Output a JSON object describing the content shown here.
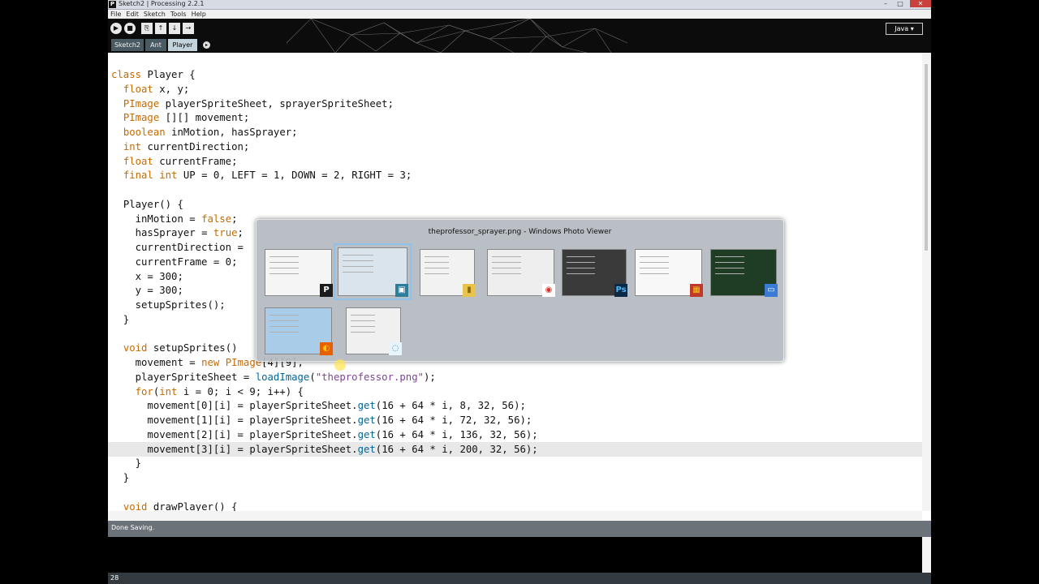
{
  "window": {
    "title": "Sketch2 | Processing 2.2.1",
    "controls": [
      "–",
      "□",
      "✕"
    ]
  },
  "menu": [
    "File",
    "Edit",
    "Sketch",
    "Tools",
    "Help"
  ],
  "toolbar": {
    "buttons": [
      {
        "name": "run",
        "glyph": "▶"
      },
      {
        "name": "stop",
        "glyph": "■"
      },
      {
        "name": "new",
        "glyph": "⎘"
      },
      {
        "name": "open",
        "glyph": "↑"
      },
      {
        "name": "save",
        "glyph": "↓"
      },
      {
        "name": "export",
        "glyph": "→"
      }
    ],
    "mode": "Java ▾"
  },
  "tabs": [
    "Sketch2",
    "Ant",
    "Player"
  ],
  "selected_tab": "Player",
  "tab_menu": "▸",
  "code_lines": [
    "class Player {",
    "  float x, y;",
    "  PImage playerSpriteSheet, sprayerSpriteSheet;",
    "  PImage [][] movement;",
    "  boolean inMotion, hasSprayer;",
    "  int currentDirection;",
    "  float currentFrame;",
    "  final int UP = 0, LEFT = 1, DOWN = 2, RIGHT = 3;",
    "",
    "  Player() {",
    "    inMotion = false;",
    "    hasSprayer = true;",
    "    currentDirection =",
    "    currentFrame = 0;",
    "    x = 300;",
    "    y = 300;",
    "    setupSprites();",
    "  }",
    "",
    "  void setupSprites()",
    "    movement = new PImage[4][9];",
    "    playerSpriteSheet = loadImage(\"theprofessor.png\");",
    "    for(int i = 0; i < 9; i++) {",
    "      movement[0][i] = playerSpriteSheet.get(16 + 64 * i, 8, 32, 56);",
    "      movement[1][i] = playerSpriteSheet.get(16 + 64 * i, 72, 32, 56);",
    "      movement[2][i] = playerSpriteSheet.get(16 + 64 * i, 136, 32, 56);",
    "      movement[3][i] = playerSpriteSheet.get(16 + 64 * i, 200, 32, 56);",
    "    }",
    "  }",
    "",
    "  void drawPlayer() {"
  ],
  "keywords": [
    "class",
    "float",
    "PImage",
    "boolean",
    "int",
    "final",
    "void",
    "new",
    "for",
    "true",
    "false"
  ],
  "functions": [
    "loadImage",
    "get"
  ],
  "current_line_index": 26,
  "status": "Done Saving.",
  "line_number": "28",
  "task_switcher": {
    "title": "theprofessor_sprayer.png - Windows Photo Viewer",
    "thumbnails": [
      {
        "app": "Processing",
        "badge": "P",
        "badge_color": "#1c1c1c",
        "badge_text_color": "#ffffff",
        "bg": "#f5f5f5",
        "selected": false
      },
      {
        "app": "Windows Photo Viewer",
        "badge": "▣",
        "badge_color": "#2e7d9a",
        "badge_text_color": "#ffffff",
        "bg": "#d9e4ec",
        "selected": true
      },
      {
        "app": "Windows Explorer",
        "badge": "▮",
        "badge_color": "#e8c44c",
        "badge_text_color": "#8a6a10",
        "bg": "#f2f2f2",
        "selected": false
      },
      {
        "app": "Google Chrome",
        "badge": "◉",
        "badge_color": "#ffffff",
        "badge_text_color": "#d93025",
        "bg": "#eeeeee",
        "selected": false
      },
      {
        "app": "Photoshop",
        "badge": "Ps",
        "badge_color": "#0b2a45",
        "badge_text_color": "#4eb5f1",
        "bg": "#3a3a3a",
        "selected": false
      },
      {
        "app": "Editor",
        "badge": "▦",
        "badge_color": "#c0392b",
        "badge_text_color": "#f5c518",
        "bg": "#f8f8f8",
        "selected": false
      },
      {
        "app": "Desktop",
        "badge": "▭",
        "badge_color": "#3a7bd5",
        "badge_text_color": "#ffffff",
        "bg": "#1f3d25",
        "selected": false
      },
      {
        "app": "Firefox",
        "badge": "◐",
        "badge_color": "#e66000",
        "badge_text_color": "#ffcb00",
        "bg": "#a9cde8",
        "selected": false
      },
      {
        "app": "Installer",
        "badge": "◌",
        "badge_color": "#e8f4fb",
        "badge_text_color": "#2a86c8",
        "bg": "#f0f0f0",
        "selected": false
      }
    ]
  },
  "colors": {
    "keyword": "#c66a00",
    "function": "#006699",
    "string": "#7d4793",
    "status_bar": "#6b7279",
    "tab_selected": "#c3d3dc"
  }
}
